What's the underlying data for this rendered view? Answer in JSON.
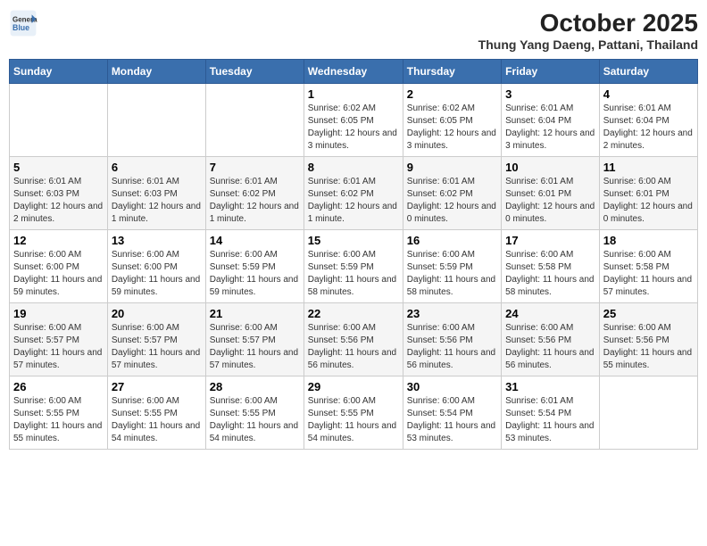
{
  "logo": {
    "general": "General",
    "blue": "Blue"
  },
  "title": "October 2025",
  "subtitle": "Thung Yang Daeng, Pattani, Thailand",
  "days_of_week": [
    "Sunday",
    "Monday",
    "Tuesday",
    "Wednesday",
    "Thursday",
    "Friday",
    "Saturday"
  ],
  "weeks": [
    [
      {
        "day": "",
        "info": ""
      },
      {
        "day": "",
        "info": ""
      },
      {
        "day": "",
        "info": ""
      },
      {
        "day": "1",
        "info": "Sunrise: 6:02 AM\nSunset: 6:05 PM\nDaylight: 12 hours and 3 minutes."
      },
      {
        "day": "2",
        "info": "Sunrise: 6:02 AM\nSunset: 6:05 PM\nDaylight: 12 hours and 3 minutes."
      },
      {
        "day": "3",
        "info": "Sunrise: 6:01 AM\nSunset: 6:04 PM\nDaylight: 12 hours and 3 minutes."
      },
      {
        "day": "4",
        "info": "Sunrise: 6:01 AM\nSunset: 6:04 PM\nDaylight: 12 hours and 2 minutes."
      }
    ],
    [
      {
        "day": "5",
        "info": "Sunrise: 6:01 AM\nSunset: 6:03 PM\nDaylight: 12 hours and 2 minutes."
      },
      {
        "day": "6",
        "info": "Sunrise: 6:01 AM\nSunset: 6:03 PM\nDaylight: 12 hours and 1 minute."
      },
      {
        "day": "7",
        "info": "Sunrise: 6:01 AM\nSunset: 6:02 PM\nDaylight: 12 hours and 1 minute."
      },
      {
        "day": "8",
        "info": "Sunrise: 6:01 AM\nSunset: 6:02 PM\nDaylight: 12 hours and 1 minute."
      },
      {
        "day": "9",
        "info": "Sunrise: 6:01 AM\nSunset: 6:02 PM\nDaylight: 12 hours and 0 minutes."
      },
      {
        "day": "10",
        "info": "Sunrise: 6:01 AM\nSunset: 6:01 PM\nDaylight: 12 hours and 0 minutes."
      },
      {
        "day": "11",
        "info": "Sunrise: 6:00 AM\nSunset: 6:01 PM\nDaylight: 12 hours and 0 minutes."
      }
    ],
    [
      {
        "day": "12",
        "info": "Sunrise: 6:00 AM\nSunset: 6:00 PM\nDaylight: 11 hours and 59 minutes."
      },
      {
        "day": "13",
        "info": "Sunrise: 6:00 AM\nSunset: 6:00 PM\nDaylight: 11 hours and 59 minutes."
      },
      {
        "day": "14",
        "info": "Sunrise: 6:00 AM\nSunset: 5:59 PM\nDaylight: 11 hours and 59 minutes."
      },
      {
        "day": "15",
        "info": "Sunrise: 6:00 AM\nSunset: 5:59 PM\nDaylight: 11 hours and 58 minutes."
      },
      {
        "day": "16",
        "info": "Sunrise: 6:00 AM\nSunset: 5:59 PM\nDaylight: 11 hours and 58 minutes."
      },
      {
        "day": "17",
        "info": "Sunrise: 6:00 AM\nSunset: 5:58 PM\nDaylight: 11 hours and 58 minutes."
      },
      {
        "day": "18",
        "info": "Sunrise: 6:00 AM\nSunset: 5:58 PM\nDaylight: 11 hours and 57 minutes."
      }
    ],
    [
      {
        "day": "19",
        "info": "Sunrise: 6:00 AM\nSunset: 5:57 PM\nDaylight: 11 hours and 57 minutes."
      },
      {
        "day": "20",
        "info": "Sunrise: 6:00 AM\nSunset: 5:57 PM\nDaylight: 11 hours and 57 minutes."
      },
      {
        "day": "21",
        "info": "Sunrise: 6:00 AM\nSunset: 5:57 PM\nDaylight: 11 hours and 57 minutes."
      },
      {
        "day": "22",
        "info": "Sunrise: 6:00 AM\nSunset: 5:56 PM\nDaylight: 11 hours and 56 minutes."
      },
      {
        "day": "23",
        "info": "Sunrise: 6:00 AM\nSunset: 5:56 PM\nDaylight: 11 hours and 56 minutes."
      },
      {
        "day": "24",
        "info": "Sunrise: 6:00 AM\nSunset: 5:56 PM\nDaylight: 11 hours and 56 minutes."
      },
      {
        "day": "25",
        "info": "Sunrise: 6:00 AM\nSunset: 5:56 PM\nDaylight: 11 hours and 55 minutes."
      }
    ],
    [
      {
        "day": "26",
        "info": "Sunrise: 6:00 AM\nSunset: 5:55 PM\nDaylight: 11 hours and 55 minutes."
      },
      {
        "day": "27",
        "info": "Sunrise: 6:00 AM\nSunset: 5:55 PM\nDaylight: 11 hours and 54 minutes."
      },
      {
        "day": "28",
        "info": "Sunrise: 6:00 AM\nSunset: 5:55 PM\nDaylight: 11 hours and 54 minutes."
      },
      {
        "day": "29",
        "info": "Sunrise: 6:00 AM\nSunset: 5:55 PM\nDaylight: 11 hours and 54 minutes."
      },
      {
        "day": "30",
        "info": "Sunrise: 6:00 AM\nSunset: 5:54 PM\nDaylight: 11 hours and 53 minutes."
      },
      {
        "day": "31",
        "info": "Sunrise: 6:01 AM\nSunset: 5:54 PM\nDaylight: 11 hours and 53 minutes."
      },
      {
        "day": "",
        "info": ""
      }
    ]
  ]
}
